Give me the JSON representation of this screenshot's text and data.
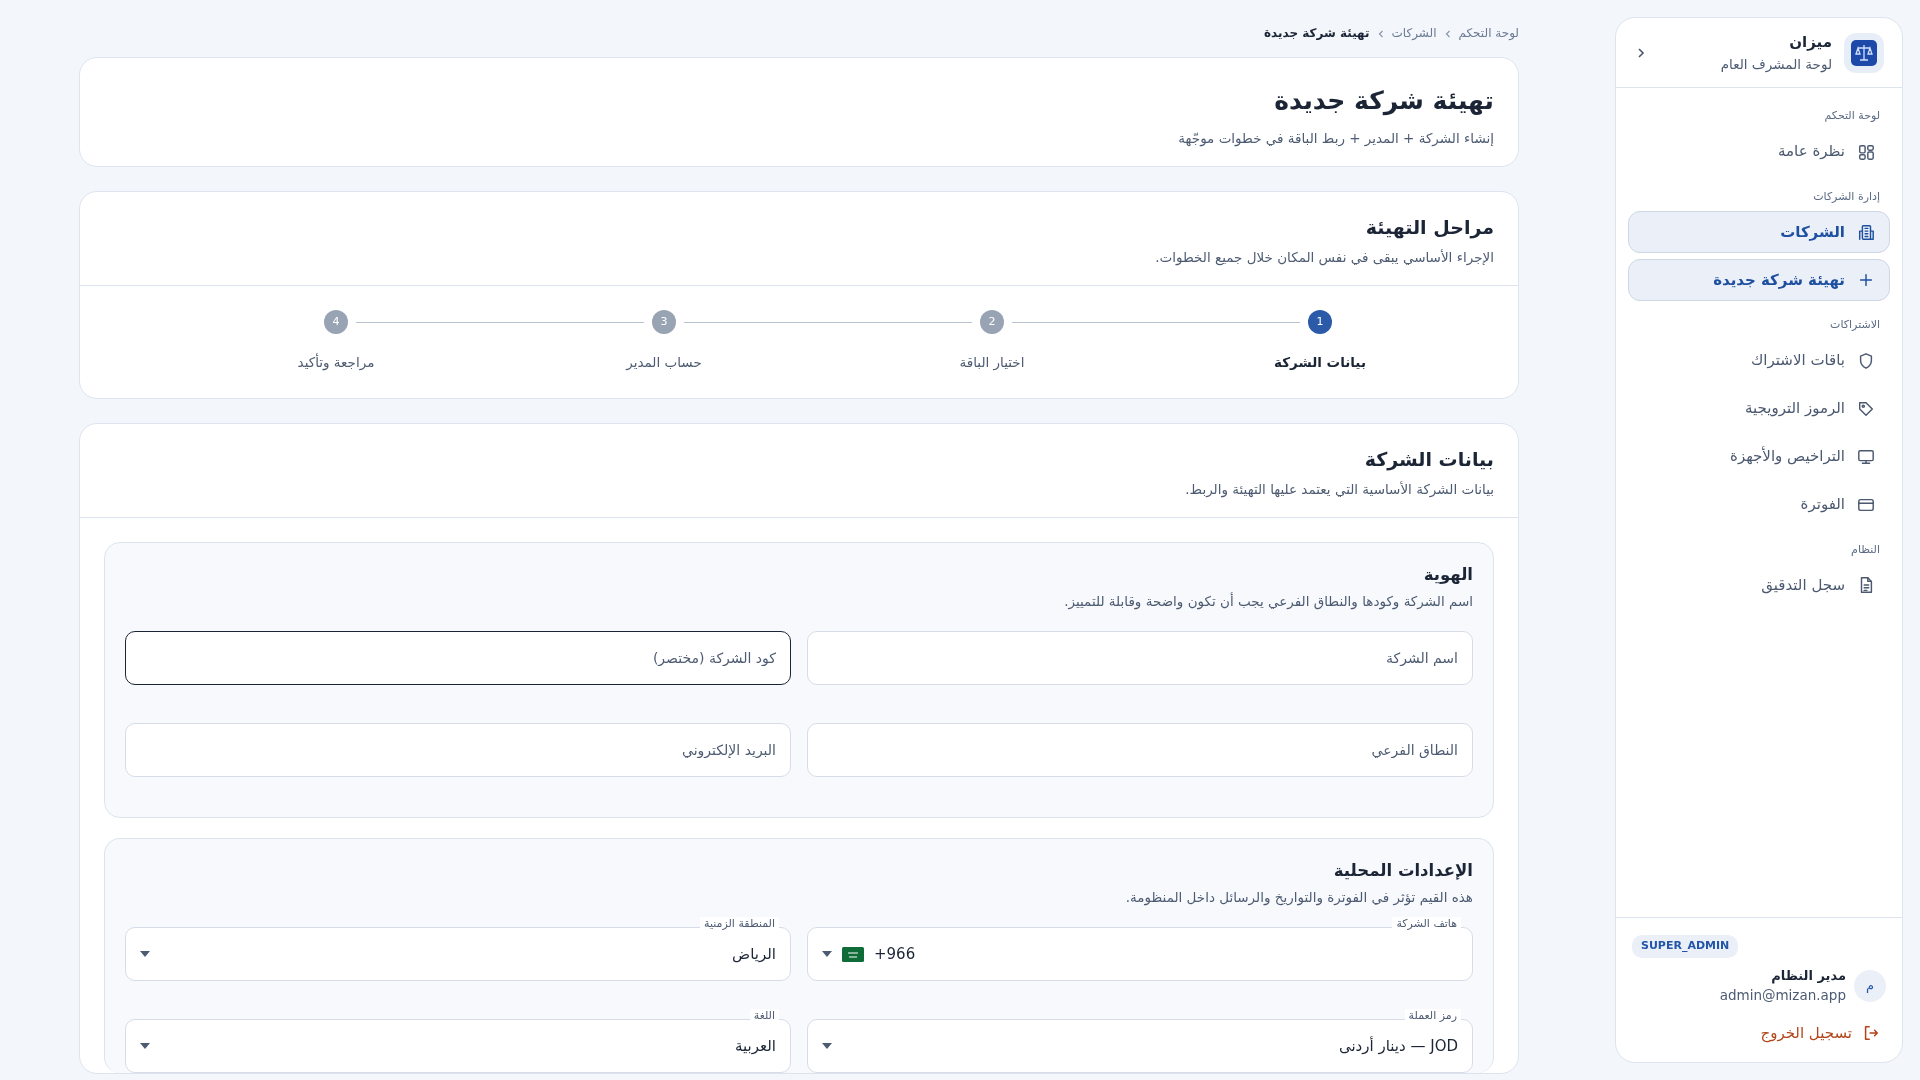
{
  "sidebar": {
    "brand": {
      "title": "ميزان",
      "subtitle": "لوحة المشرف العام"
    },
    "sections": [
      {
        "title": "لوحة التحكم",
        "items": [
          {
            "label": "نظرة عامة",
            "selected": false
          }
        ]
      },
      {
        "title": "إدارة الشركات",
        "items": [
          {
            "label": "الشركات",
            "selected": true
          },
          {
            "label": "تهيئة شركة جديدة",
            "selected": true
          }
        ]
      },
      {
        "title": "الاشتراكات",
        "items": [
          {
            "label": "باقات الاشتراك",
            "selected": false
          },
          {
            "label": "الرموز الترويجية",
            "selected": false
          },
          {
            "label": "التراخيص والأجهزة",
            "selected": false
          },
          {
            "label": "الفوترة",
            "selected": false
          }
        ]
      },
      {
        "title": "النظام",
        "items": [
          {
            "label": "سجل التدقيق",
            "selected": false
          }
        ]
      }
    ],
    "user": {
      "role": "SUPER_ADMIN",
      "avatar": "م",
      "name": "مدير النظام",
      "email": "admin@mizan.app"
    },
    "logout": "تسجيل الخروج"
  },
  "breadcrumb": [
    {
      "label": "لوحة التحكم",
      "current": false
    },
    {
      "label": "الشركات",
      "current": false
    },
    {
      "label": "تهيئة شركة جديدة",
      "current": true
    }
  ],
  "header": {
    "title": "تهيئة شركة جديدة",
    "subtitle": "إنشاء الشركة + المدير + ربط الباقة في خطوات موجّهة"
  },
  "stepper": {
    "title": "مراحل التهيئة",
    "subtitle": "الإجراء الأساسي يبقى في نفس المكان خلال جميع الخطوات.",
    "steps": [
      {
        "number": "1",
        "label": "بيانات الشركة",
        "selected": true
      },
      {
        "number": "2",
        "label": "اختيار الباقة",
        "selected": false
      },
      {
        "number": "3",
        "label": "حساب المدير",
        "selected": false
      },
      {
        "number": "4",
        "label": "مراجعة وتأكيد",
        "selected": false
      }
    ]
  },
  "form": {
    "title": "بيانات الشركة",
    "subtitle": "بيانات الشركة الأساسية التي يعتمد عليها التهيئة والربط.",
    "sections": [
      {
        "title": "الهوية",
        "subtitle": "اسم الشركة وكودها والنطاق الفرعي يجب أن تكون واضحة وقابلة للتمييز.",
        "fields": [
          {
            "kind": "text",
            "placeholder": "اسم الشركة",
            "focused": false
          },
          {
            "kind": "text",
            "placeholder": "كود الشركة (مختصر)",
            "focused": true
          },
          {
            "kind": "text",
            "placeholder": "النطاق الفرعي",
            "focused": false
          },
          {
            "kind": "text",
            "placeholder": "البريد الإلكتروني",
            "focused": false
          }
        ]
      },
      {
        "title": "الإعدادات المحلية",
        "subtitle": "هذه القيم تؤثر في الفوترة والتواريخ والرسائل داخل المنظومة.",
        "fields": [
          {
            "kind": "phone",
            "label": "هاتف الشركة",
            "value": "+966",
            "focused": false
          },
          {
            "kind": "select",
            "label": "المنطقة الزمنية",
            "value": "الرياض",
            "focused": false
          },
          {
            "kind": "select",
            "label": "رمز العملة",
            "value": "JOD — دينار أردنى",
            "focused": false
          },
          {
            "kind": "select",
            "label": "اللغة",
            "value": "العربية",
            "focused": false
          }
        ]
      }
    ]
  }
}
